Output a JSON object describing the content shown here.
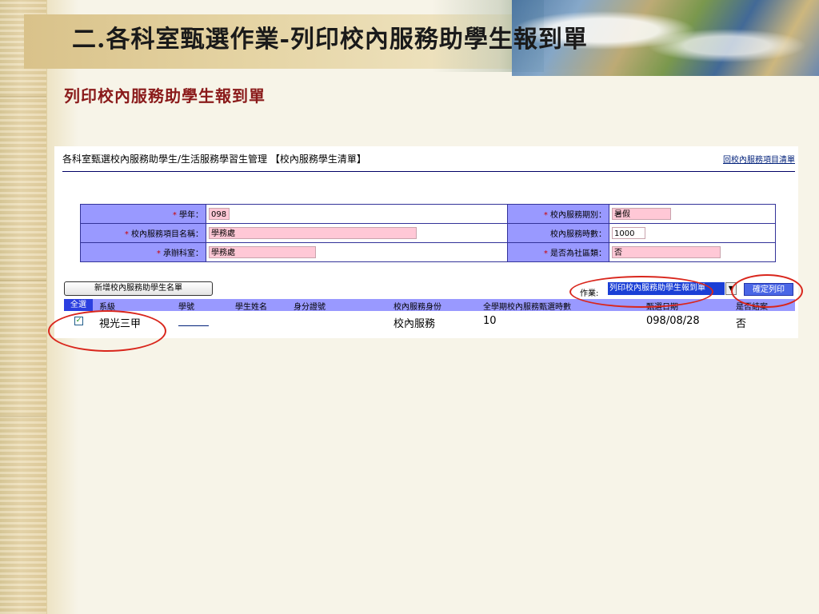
{
  "slide": {
    "title": "二.各科室甄選作業-列印校內服務助學生報到單",
    "subtitle": "列印校內服務助學生報到單"
  },
  "app": {
    "breadcrumb": "各科室甄選校內服務助學生/生活服務學習生管理 【校內服務學生清單】",
    "back_link": "回校內服務項目清單"
  },
  "form": {
    "year_label": "學年：",
    "year_value": "098",
    "period_label": "校內服務期別：",
    "period_value": "暑假",
    "item_name_label": "校內服務項目名稱：",
    "item_name_value": "學務處",
    "hours_label": "校內服務時數：",
    "hours_value": "1000",
    "office_label": "承辦科室：",
    "office_value": "學務處",
    "is_social_label": "是否為社區類：",
    "is_social_value": "否",
    "required_mark": "*"
  },
  "toolbar": {
    "add_button": "新增校內服務助學生名單",
    "operation_label": "作業:",
    "operation_selected": "列印校內服務助學生報到單",
    "print_button": "確定列印"
  },
  "grid": {
    "select_all": "全選",
    "headers": {
      "class": "系級",
      "student_id": "學號",
      "name": "學生姓名",
      "id_number": "身分證號",
      "identity": "校內服務身份",
      "semester_hours": "全學期校內服務甄選時數",
      "date": "甄選日期",
      "closed": "是否結案"
    },
    "rows": [
      {
        "class": "視光三甲",
        "student_id": "",
        "name": "",
        "id_number": "",
        "identity": "校內服務",
        "semester_hours": "10",
        "date": "098/08/28",
        "closed": "否"
      }
    ]
  },
  "colors": {
    "label_bg": "#9999ff",
    "input_bg": "#ffc8d6",
    "annotation": "#d9261c",
    "subtitle": "#8a1a1a"
  }
}
